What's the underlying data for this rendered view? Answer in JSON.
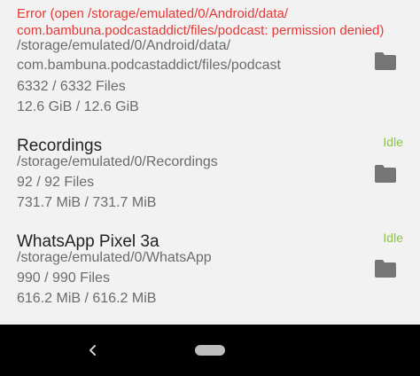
{
  "items": [
    {
      "error": "Error (open /storage/emulated/0/Android/data/ com.bambuna.podcastaddict/files/podcast: permission denied)",
      "path_line1": "/storage/emulated/0/Android/data/",
      "path_line2": "com.bambuna.podcastaddict/files/podcast",
      "files": "6332 / 6332 Files",
      "size": "12.6 GiB / 12.6 GiB",
      "icon": "folder-icon"
    },
    {
      "title": "Recordings",
      "status": "Idle",
      "path": "/storage/emulated/0/Recordings",
      "files": "92 / 92 Files",
      "size": "731.7 MiB / 731.7 MiB",
      "icon": "folder-icon"
    },
    {
      "title": "WhatsApp Pixel 3a",
      "status": "Idle",
      "path": "/storage/emulated/0/WhatsApp",
      "files": "990 / 990 Files",
      "size": "616.2 MiB / 616.2 MiB",
      "icon": "folder-icon"
    }
  ],
  "nav": {
    "back_icon": "chevron-left-icon",
    "home_icon": "home-pill"
  },
  "colors": {
    "error": "#e53935",
    "status_idle": "#8bc34a",
    "title": "#222222",
    "secondary_text": "#6b6b6b",
    "folder_icon": "#757575",
    "background": "#f2f2f2",
    "navbar": "#000000"
  }
}
